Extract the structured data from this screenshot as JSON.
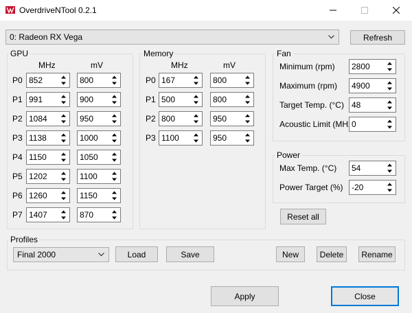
{
  "window": {
    "title": "OverdriveNTool 0.2.1",
    "icon": "radeon-logo-icon"
  },
  "device": {
    "selected": "0: Radeon RX Vega",
    "refresh_label": "Refresh"
  },
  "gpu": {
    "title": "GPU",
    "col_mhz": "MHz",
    "col_mv": "mV",
    "states": [
      {
        "label": "P0",
        "mhz": "852",
        "mv": "800"
      },
      {
        "label": "P1",
        "mhz": "991",
        "mv": "900"
      },
      {
        "label": "P2",
        "mhz": "1084",
        "mv": "950"
      },
      {
        "label": "P3",
        "mhz": "1138",
        "mv": "1000"
      },
      {
        "label": "P4",
        "mhz": "1150",
        "mv": "1050"
      },
      {
        "label": "P5",
        "mhz": "1202",
        "mv": "1100"
      },
      {
        "label": "P6",
        "mhz": "1260",
        "mv": "1150"
      },
      {
        "label": "P7",
        "mhz": "1407",
        "mv": "870"
      }
    ]
  },
  "memory": {
    "title": "Memory",
    "col_mhz": "MHz",
    "col_mv": "mV",
    "states": [
      {
        "label": "P0",
        "mhz": "167",
        "mv": "800"
      },
      {
        "label": "P1",
        "mhz": "500",
        "mv": "800"
      },
      {
        "label": "P2",
        "mhz": "800",
        "mv": "950"
      },
      {
        "label": "P3",
        "mhz": "1100",
        "mv": "950"
      }
    ]
  },
  "fan": {
    "title": "Fan",
    "fields": [
      {
        "label": "Minimum (rpm)",
        "value": "2800"
      },
      {
        "label": "Maximum (rpm)",
        "value": "4900"
      },
      {
        "label": "Target Temp. (°C)",
        "value": "48"
      },
      {
        "label": "Acoustic Limit (MHz)",
        "value": "0"
      }
    ]
  },
  "power": {
    "title": "Power",
    "fields": [
      {
        "label": "Max Temp. (°C)",
        "value": "54"
      },
      {
        "label": "Power Target (%)",
        "value": "-20"
      }
    ]
  },
  "reset_all_label": "Reset all",
  "profiles": {
    "title": "Profiles",
    "selected": "Final 2000",
    "load_label": "Load",
    "save_label": "Save",
    "new_label": "New",
    "delete_label": "Delete",
    "rename_label": "Rename"
  },
  "footer": {
    "apply_label": "Apply",
    "close_label": "Close"
  },
  "colors": {
    "accent": "#0078d7",
    "background": "#f0f0f0"
  }
}
